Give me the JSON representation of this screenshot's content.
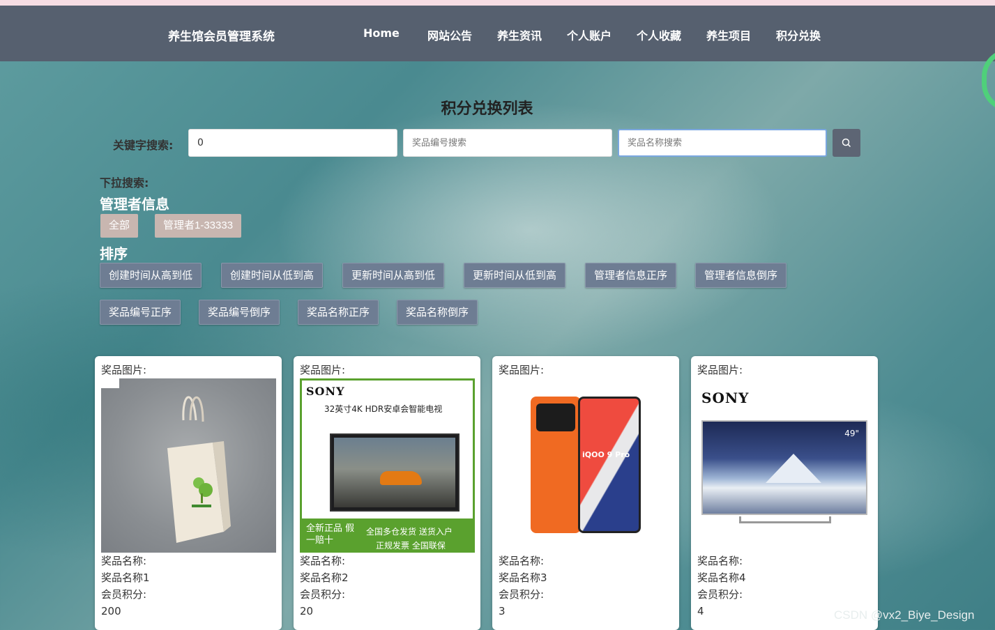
{
  "nav": {
    "brand": "养生馆会员管理系统",
    "items": [
      "Home",
      "网站公告",
      "养生资讯",
      "个人账户",
      "个人收藏",
      "养生项目",
      "积分兑换"
    ]
  },
  "page_title": "积分兑换列表",
  "search": {
    "label": "关键字搜索:",
    "field1_value": "0",
    "field2_placeholder": "奖品编号搜索",
    "field3_placeholder": "奖品名称搜索"
  },
  "dropdown_label": "下拉搜索:",
  "admin_section": {
    "title": "管理者信息",
    "chips": [
      "全部",
      "管理者1-33333"
    ]
  },
  "sort_section": {
    "title": "排序",
    "buttons": [
      "创建时间从高到低",
      "创建时间从低到高",
      "更新时间从高到低",
      "更新时间从低到高",
      "管理者信息正序",
      "管理者信息倒序",
      "奖品编号正序",
      "奖品编号倒序",
      "奖品名称正序",
      "奖品名称倒序"
    ]
  },
  "cards": [
    {
      "image_label": "奖品图片:",
      "name_label": "奖品名称:",
      "name": "奖品名称1",
      "points_label": "会员积分:",
      "points": "200",
      "image": "tote-bag"
    },
    {
      "image_label": "奖品图片:",
      "name_label": "奖品名称:",
      "name": "奖品名称2",
      "points_label": "会员积分:",
      "points": "20",
      "image": "sony-tv-ad",
      "ad_brand": "SONY",
      "ad_title": "32英寸4K HDR安卓会智能电视",
      "ad_left": "全新正品 假一赔十",
      "ad_right1": "全国多仓发货 送货入户",
      "ad_right2": "正规发票 全国联保"
    },
    {
      "image_label": "奖品图片:",
      "name_label": "奖品名称:",
      "name": "奖品名称3",
      "points_label": "会员积分:",
      "points": "3",
      "image": "orange-phone",
      "phone_brand": "iQOO 9 Pro"
    },
    {
      "image_label": "奖品图片:",
      "name_label": "奖品名称:",
      "name": "奖品名称4",
      "points_label": "会员积分:",
      "points": "4",
      "image": "sony-tv",
      "ad_brand": "SONY",
      "tv_size": "49\""
    }
  ],
  "watermark": "CSDN @vx2_Biye_Design",
  "colors": {
    "navbar": "#56606f",
    "sort_button": "#6e7d93",
    "chip": "#c8b6b0"
  }
}
